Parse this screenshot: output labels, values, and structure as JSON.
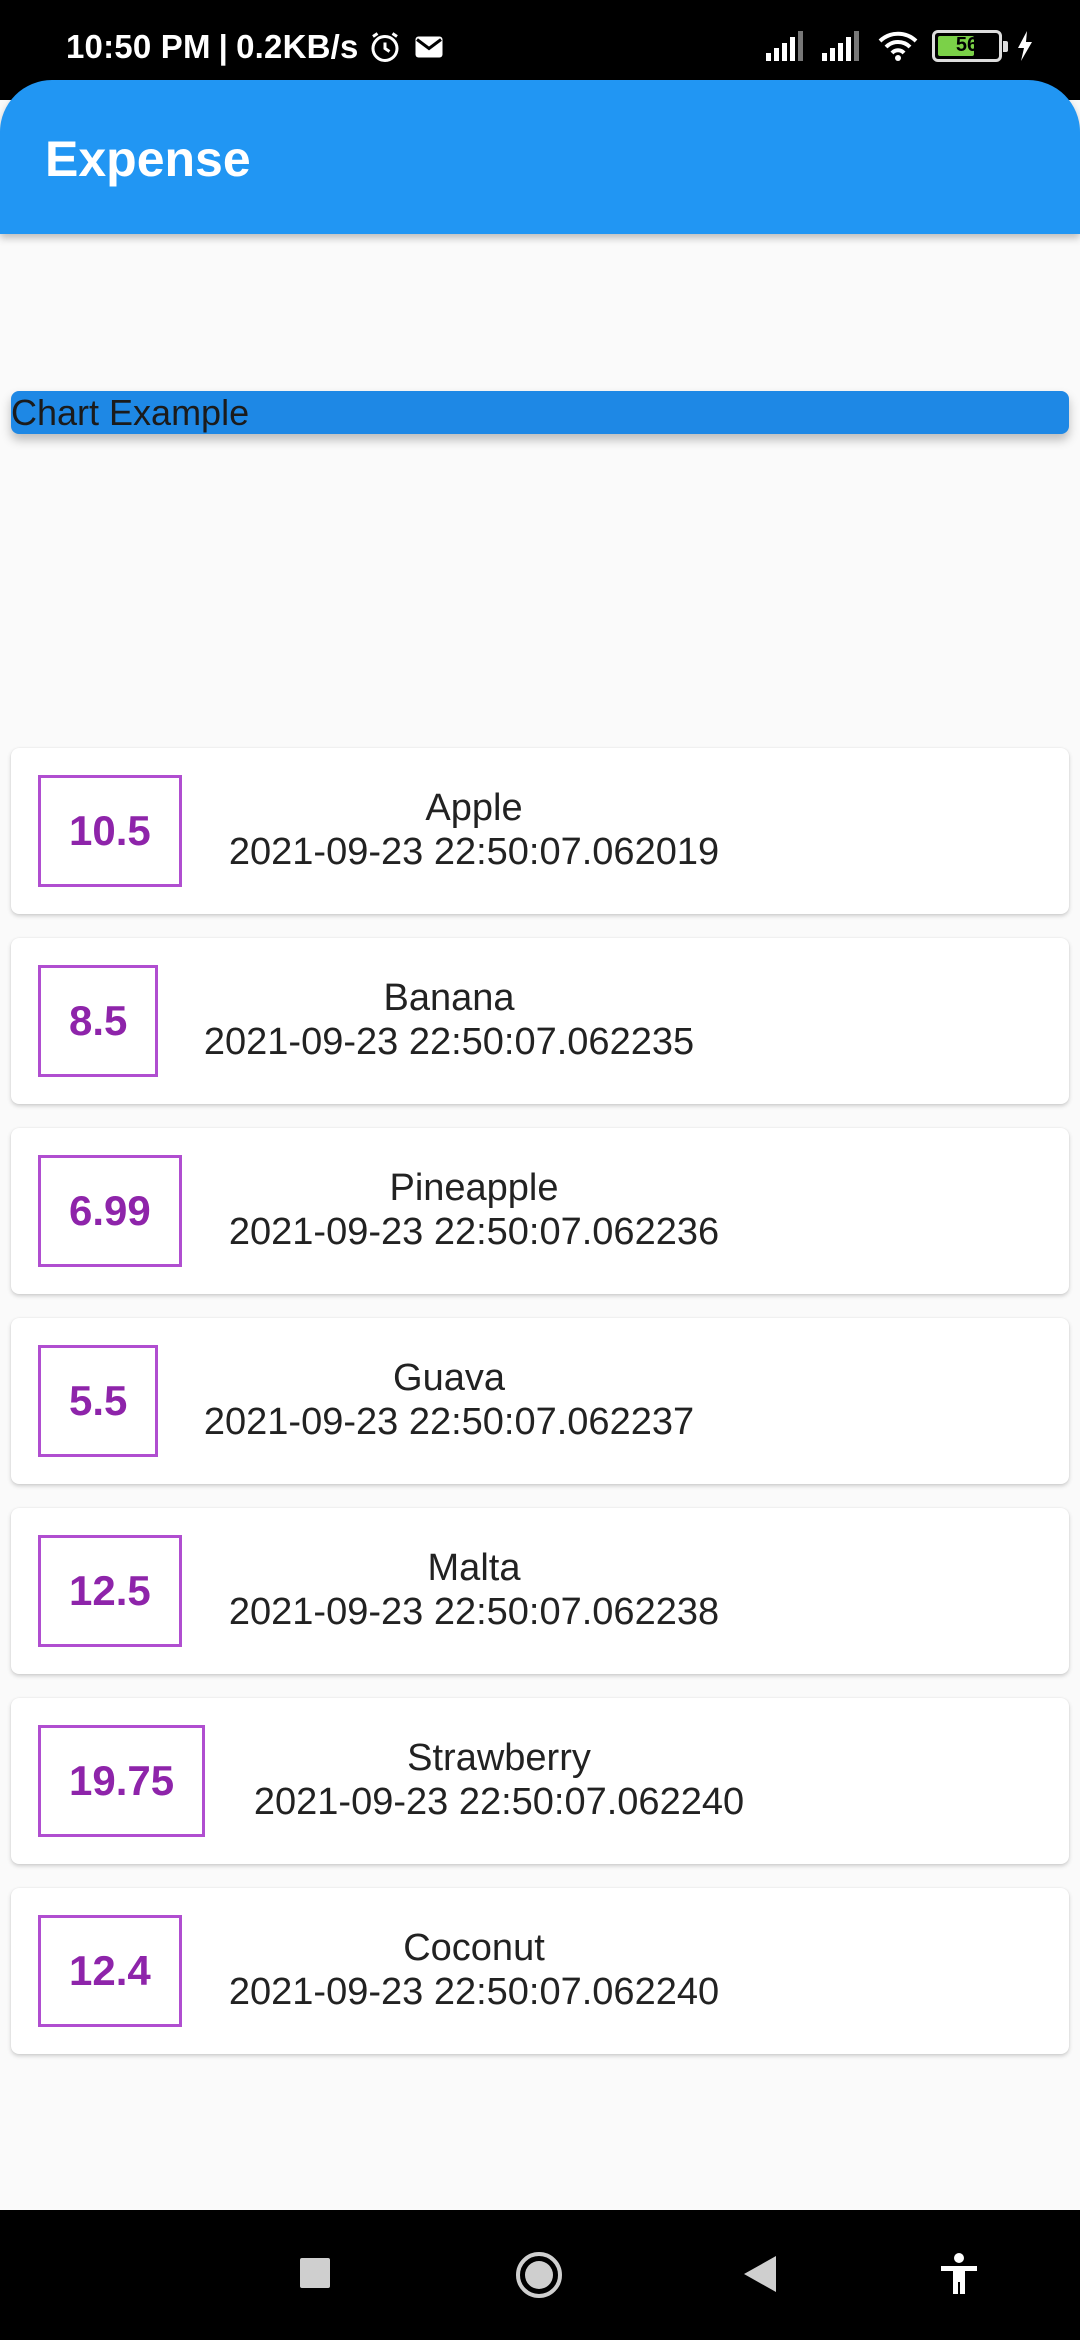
{
  "status": {
    "time": "10:50 PM",
    "speed": "0.2KB/s",
    "battery": "56"
  },
  "appbar": {
    "title": "Expense"
  },
  "chart_banner": {
    "label": "Chart Example"
  },
  "transactions": [
    {
      "amount": "10.5",
      "title": "Apple",
      "date": "2021-09-23 22:50:07.062019"
    },
    {
      "amount": "8.5",
      "title": "Banana",
      "date": "2021-09-23 22:50:07.062235"
    },
    {
      "amount": "6.99",
      "title": "Pineapple",
      "date": "2021-09-23 22:50:07.062236"
    },
    {
      "amount": "5.5",
      "title": "Guava",
      "date": "2021-09-23 22:50:07.062237"
    },
    {
      "amount": "12.5",
      "title": "Malta",
      "date": "2021-09-23 22:50:07.062238"
    },
    {
      "amount": "19.75",
      "title": "Strawberry",
      "date": "2021-09-23 22:50:07.062240"
    },
    {
      "amount": "12.4",
      "title": "Coconut",
      "date": "2021-09-23 22:50:07.062240"
    }
  ],
  "colors": {
    "appbar": "#2196f3",
    "banner": "#1e88e5",
    "amount_text": "#8e24aa",
    "amount_border": "#b04ed0"
  },
  "navbar": {
    "icons": [
      "recents-square-icon",
      "home-circle-icon",
      "back-triangle-icon",
      "accessibility-icon"
    ]
  }
}
